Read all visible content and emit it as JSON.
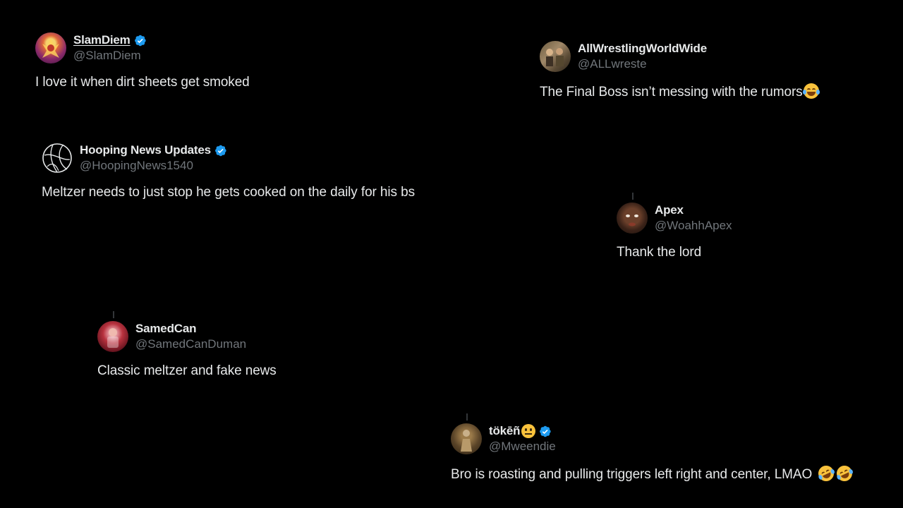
{
  "colors": {
    "background": "#000000",
    "text": "#e7e9ea",
    "handle": "#71767b",
    "verified": "#1d9bf0"
  },
  "tweets": [
    {
      "display_name": "SlamDiem",
      "handle": "@SlamDiem",
      "verified": true,
      "text": "I love it when dirt sheets get smoked",
      "avatar_icon": "avatar-wrestler-icon"
    },
    {
      "display_name": "AllWrestlingWorldWide",
      "handle": "@ALLwreste",
      "verified": false,
      "text": "The Final Boss isn’t messing with the rumors",
      "emoji": [
        "tears-of-joy-emoji"
      ],
      "avatar_icon": "avatar-group-photo-icon"
    },
    {
      "display_name": "Hooping News Updates",
      "handle": "@HoopingNews1540",
      "verified": true,
      "text": "Meltzer needs to just stop he gets cooked on the daily for his bs",
      "avatar_icon": "basketball-icon"
    },
    {
      "display_name": "Apex",
      "handle": "@WoahhApex",
      "verified": false,
      "text": "Thank the lord",
      "avatar_icon": "avatar-face-icon"
    },
    {
      "display_name": "SamedCan",
      "handle": "@SamedCanDuman",
      "verified": false,
      "text": "Classic meltzer and fake news",
      "avatar_icon": "avatar-red-icon"
    },
    {
      "display_name": "tökēñ",
      "handle": "@Mweendie",
      "verified": true,
      "text": "Bro is roasting and pulling triggers left right and center, LMAO",
      "emoji": [
        "rolling-on-floor-laughing-emoji",
        "rolling-on-floor-laughing-emoji"
      ],
      "name_emoji": "neutral-face-emoji",
      "avatar_icon": "avatar-figure-icon"
    }
  ]
}
